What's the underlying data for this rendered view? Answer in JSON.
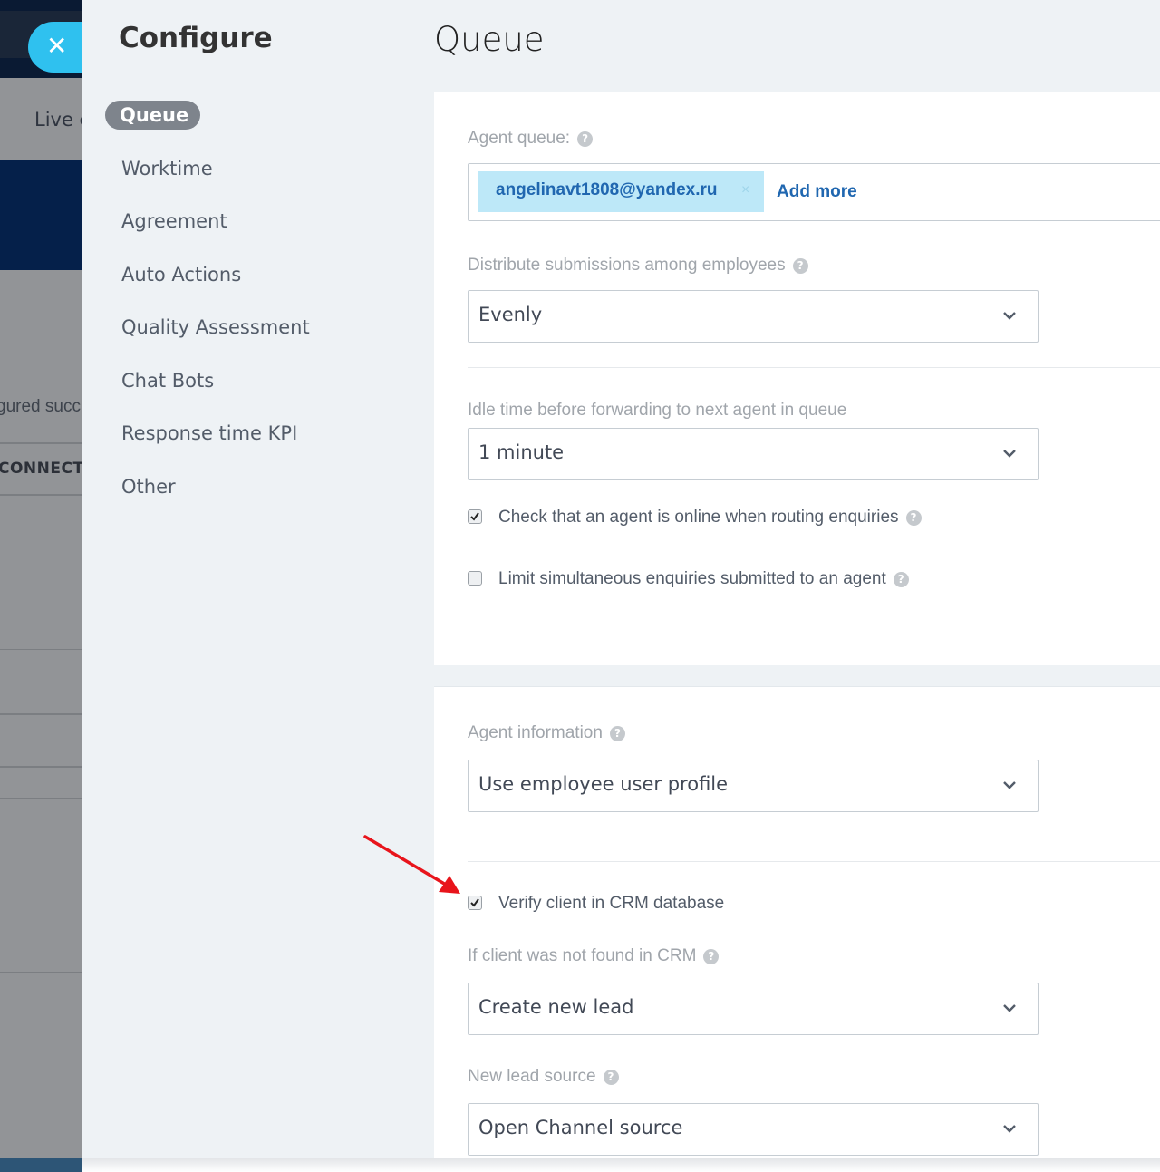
{
  "background_app": {
    "tab_label": "Live c",
    "status_fragment": "gured succ",
    "connect_label": "CONNECT"
  },
  "close_button": {
    "icon": "close-icon",
    "glyph": "✕"
  },
  "sidebar": {
    "title": "Configure",
    "items": [
      {
        "label": "Queue",
        "active": true
      },
      {
        "label": "Worktime",
        "active": false
      },
      {
        "label": "Agreement",
        "active": false
      },
      {
        "label": "Auto Actions",
        "active": false
      },
      {
        "label": "Quality Assessment",
        "active": false
      },
      {
        "label": "Chat Bots",
        "active": false
      },
      {
        "label": "Response time KPI",
        "active": false
      },
      {
        "label": "Other",
        "active": false
      }
    ]
  },
  "page": {
    "title": "Queue",
    "help_glyph": "?",
    "section1": {
      "agent_queue_label": "Agent queue:",
      "agent_queue_tags": [
        {
          "text": "angelinavt1808@yandex.ru",
          "remove_glyph": "×"
        }
      ],
      "add_more_label": "Add more",
      "distribute_label": "Distribute submissions among employees",
      "distribute_value": "Evenly",
      "idle_label": "Idle time before forwarding to next agent in queue",
      "idle_value": "1 minute",
      "check_online": {
        "label": "Check that an agent is online when routing enquiries",
        "checked": true
      },
      "limit_simultaneous": {
        "label": "Limit simultaneous enquiries submitted to an agent",
        "checked": false
      }
    },
    "section2": {
      "agent_info_label": "Agent information",
      "agent_info_value": "Use employee user profile",
      "verify_crm": {
        "label": "Verify client in CRM database",
        "checked": true
      },
      "not_found_label": "If client was not found in CRM",
      "not_found_value": "Create new lead",
      "lead_source_label": "New lead source",
      "lead_source_value": "Open Channel source"
    }
  },
  "annotation": {
    "type": "red-arrow",
    "color": "#e8141b",
    "points_to": "verify-crm-checkbox"
  },
  "colors": {
    "accent": "#2fc1ef",
    "link": "#2067b0",
    "tag_bg": "#bde8f8",
    "active_menu_bg": "#7e848c"
  }
}
